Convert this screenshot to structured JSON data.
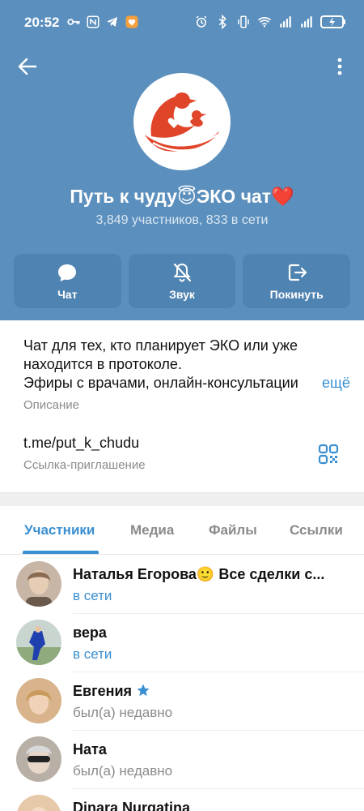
{
  "status_bar": {
    "time": "20:52",
    "left_icons": [
      "key-icon",
      "nfc-icon",
      "telegram-icon",
      "app-notification-icon"
    ],
    "right_icons": [
      "alarm-icon",
      "bluetooth-icon",
      "vibrate-icon",
      "wifi-icon",
      "signal-icon",
      "signal-icon",
      "battery-icon"
    ]
  },
  "header": {
    "back_icon": "back-arrow-icon",
    "more_icon": "more-vertical-icon",
    "avatar_icon": "bird-logo-icon",
    "title": "Путь к чуду😇ЭКО чат❤️",
    "subtitle": "3,849 участников, 833 в сети",
    "background_color": "#5b8fbd",
    "accent_color": "#e0452a"
  },
  "actions": [
    {
      "label": "Чат",
      "icon": "chat-icon"
    },
    {
      "label": "Звук",
      "icon": "bell-off-icon"
    },
    {
      "label": "Покинуть",
      "icon": "leave-icon"
    }
  ],
  "info": {
    "description_line1": "Чат для тех, кто планирует ЭКО или уже",
    "description_line2": "находится в протоколе.",
    "description_line3": "Эфиры с врачами, онлайн-консультации",
    "more_label": "ещё",
    "description_label": "Описание",
    "invite_link": "t.me/put_k_chudu",
    "invite_label": "Ссылка-приглашение",
    "qr_icon": "qr-code-icon",
    "link_color": "#3a8fd1"
  },
  "tabs": [
    {
      "label": "Участники",
      "active": true
    },
    {
      "label": "Медиа",
      "active": false
    },
    {
      "label": "Файлы",
      "active": false
    },
    {
      "label": "Ссылки",
      "active": false
    }
  ],
  "members": [
    {
      "name": "Наталья Егорова🙂 Все сделки с...",
      "status": "в сети",
      "online": true
    },
    {
      "name": "вера",
      "status": "в сети",
      "online": true
    },
    {
      "name": "Евгения",
      "status": "был(а) недавно",
      "online": false,
      "badge": "star-icon"
    },
    {
      "name": "Ната",
      "status": "был(а) недавно",
      "online": false
    },
    {
      "name": "Dinara Nurgatina",
      "status": "",
      "online": false
    }
  ]
}
